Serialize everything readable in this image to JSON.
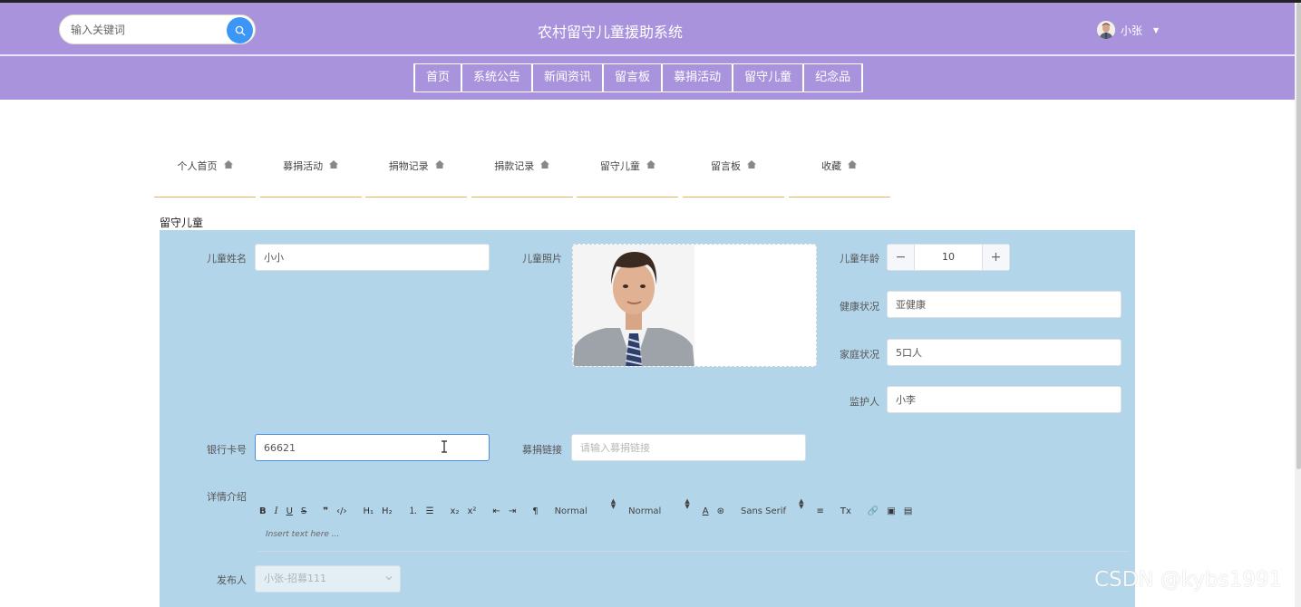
{
  "header": {
    "search": {
      "placeholder": "输入关键词"
    },
    "title": "农村留守儿童援助系统",
    "user": {
      "name": "小张"
    }
  },
  "nav": [
    "首页",
    "系统公告",
    "新闻资讯",
    "留言板",
    "募捐活动",
    "留守儿童",
    "纪念品"
  ],
  "tabs": [
    "个人首页",
    "募捐活动",
    "捐物记录",
    "捐款记录",
    "留守儿童",
    "留言板",
    "收藏"
  ],
  "section_title": "留守儿童",
  "form": {
    "child_name": {
      "label": "儿童姓名",
      "value": "小小"
    },
    "child_photo": {
      "label": "儿童照片"
    },
    "child_age": {
      "label": "儿童年龄",
      "value": "10",
      "minus": "−",
      "plus": "+"
    },
    "health": {
      "label": "健康状况",
      "value": "亚健康"
    },
    "family": {
      "label": "家庭状况",
      "value": "5口人"
    },
    "guardian": {
      "label": "监护人",
      "value": "小李"
    },
    "bank_card": {
      "label": "银行卡号",
      "value": "66621"
    },
    "donation_link": {
      "label": "募捐链接",
      "placeholder": "请输入募捐链接"
    },
    "details": {
      "label": "详情介绍",
      "toolbar": {
        "bold": "B",
        "italic": "I",
        "underline": "U",
        "strike": "S",
        "quote": "❞",
        "code": "‹/›",
        "h1": "H₁",
        "h2": "H₂",
        "ordered": "⒈",
        "bullet": "☰",
        "sub": "x₂",
        "sup": "x²",
        "outdent": "⇤",
        "indent": "⇥",
        "direction": "¶",
        "size": "Normal",
        "header": "Normal",
        "color": "A",
        "background": "⊛",
        "font": "Sans Serif",
        "align": "≡",
        "clean": "Tx",
        "link": "🔗",
        "image": "▣",
        "video": "▤"
      },
      "placeholder": "Insert text here ..."
    },
    "publisher": {
      "label": "发布人",
      "value": "小张-招募111"
    }
  },
  "watermark": "CSDN @kybs1991"
}
